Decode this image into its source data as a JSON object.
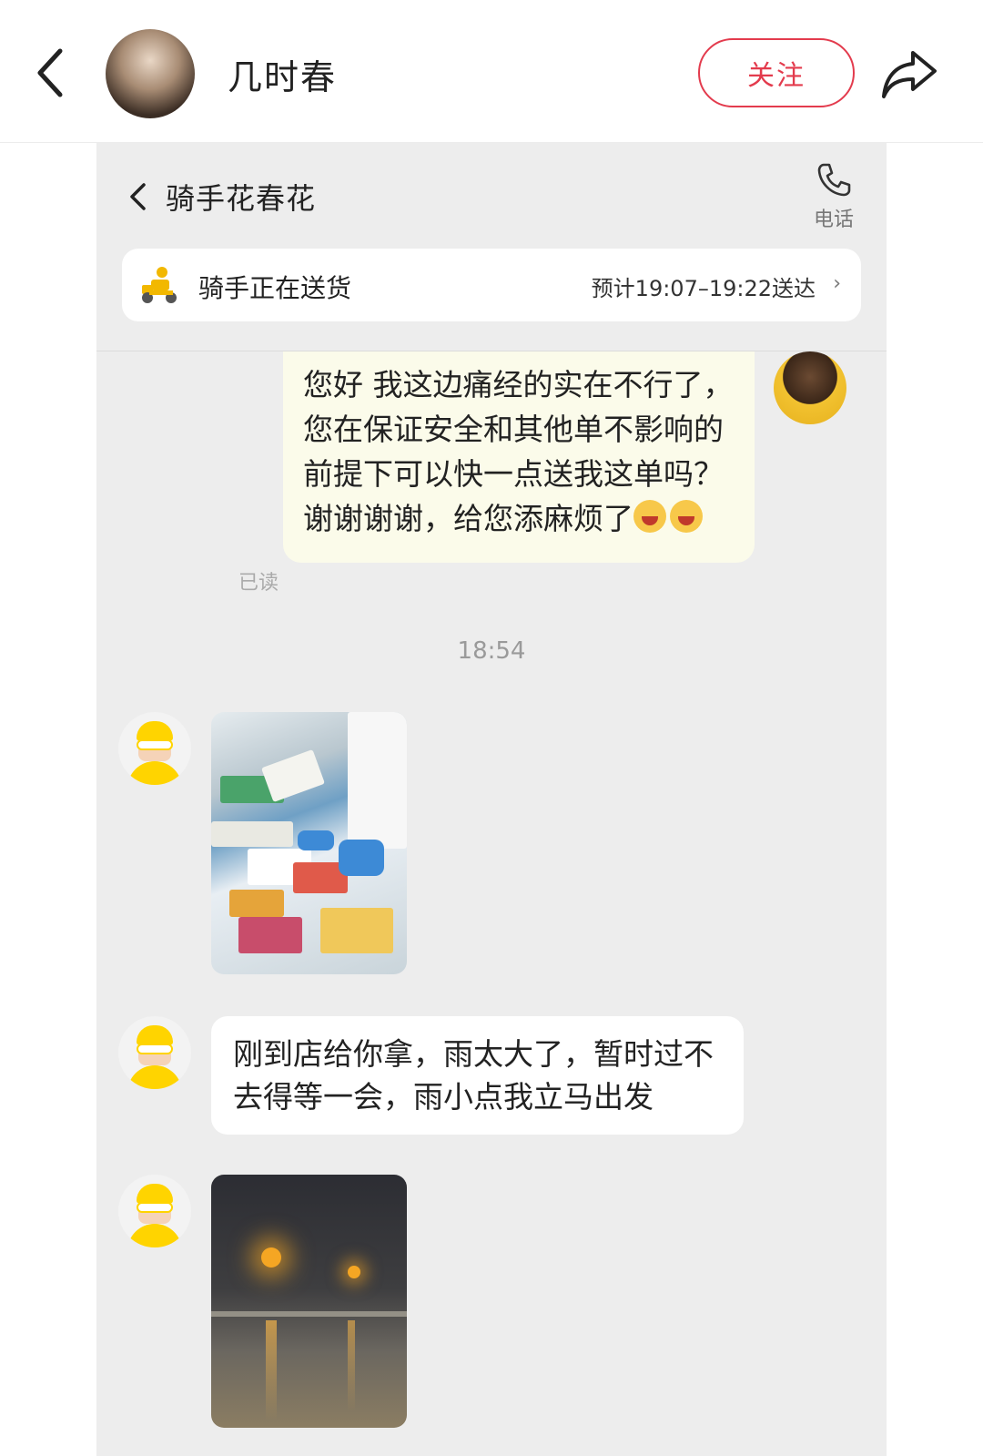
{
  "post": {
    "author_name": "几时春",
    "follow_label": "关注"
  },
  "chat": {
    "title": "骑手花春花",
    "call_label": "电话",
    "status": {
      "text": "骑手正在送货",
      "eta": "预计19:07–19:22送达"
    },
    "messages": [
      {
        "type": "text",
        "side": "right",
        "text": "您好 我这边痛经的实在不行了，您在保证安全和其他单不影响的前提下可以快一点送我这单吗？谢谢谢谢，给您添麻烦了",
        "read_label": "已读"
      },
      {
        "type": "time",
        "text": "18:54"
      },
      {
        "type": "image",
        "side": "left",
        "description": "pharmacy-counter-photo"
      },
      {
        "type": "text",
        "side": "left",
        "text": "刚到店给你拿，雨太大了，暂时过不去得等一会，雨小点我立马出发"
      },
      {
        "type": "image",
        "side": "left",
        "description": "rainy-street-photo"
      }
    ]
  },
  "colors": {
    "accent": "#e33b4d",
    "my_bubble": "#fbfbea",
    "chat_bg": "#ededed",
    "rider_yellow": "#ffd400"
  },
  "icons": [
    "back-arrow-icon",
    "share-icon",
    "chevron-left-icon",
    "phone-icon",
    "rider-scooter-icon",
    "chevron-right-icon",
    "crying-emoji-icon"
  ]
}
